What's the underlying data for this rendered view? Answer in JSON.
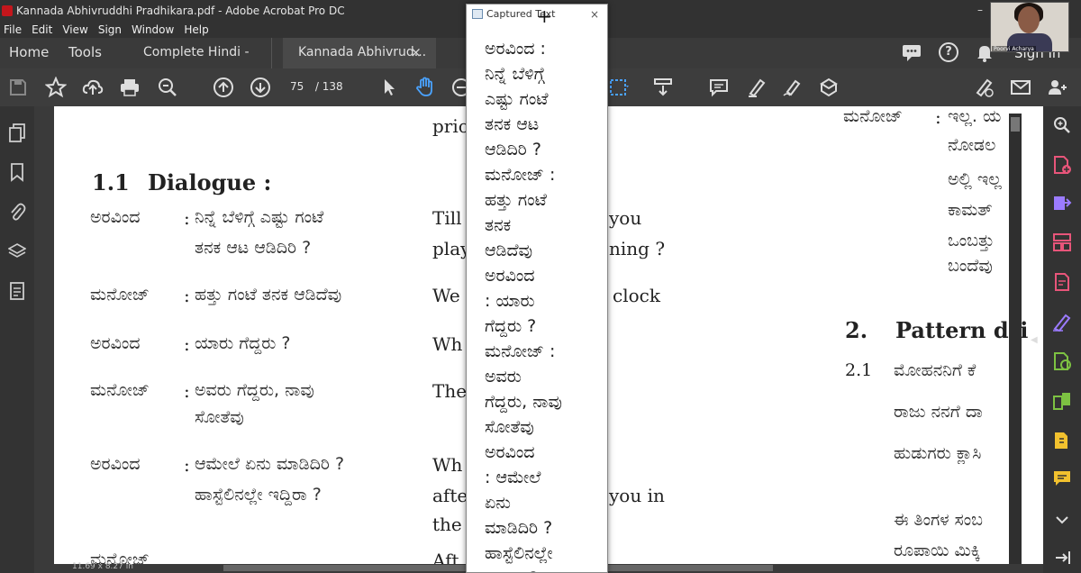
{
  "window": {
    "title": "Kannada Abhivruddhi Pradhikara.pdf - Adobe Acrobat Pro DC",
    "minimize": "–"
  },
  "menu": [
    "File",
    "Edit",
    "View",
    "Sign",
    "Window",
    "Help"
  ],
  "tabs": {
    "home": "Home",
    "tools": "Tools",
    "doc1": "Complete Hindi - R...",
    "doc2": "Kannada Abhivrud...",
    "close": "×",
    "signin": "Sign In"
  },
  "toolbar": {
    "page_current": "75",
    "page_sep": "/",
    "page_total": "138"
  },
  "status": {
    "page_size": "11.69 x 8.27 in"
  },
  "webcam": {
    "name": "Poorvi Acharya"
  },
  "popup": {
    "title": "Captured Text",
    "close": "×",
    "lines": [
      "ಅರವಿಂದ :",
      "ನಿನ್ನೆ ಬೆಳಿಗ್ಗೆ",
      "ಎಷ್ಟು ಗಂಟೆ",
      "ತನಕ ಆಟ",
      "ಆಡಿದಿರಿ ?",
      "ಮನೋಜ್ :",
      "ಹತ್ತು ಗಂಟೆ",
      "ತನಕ",
      "ಆಡಿದೆವು",
      "ಅರವಿಂದ",
      ": ಯಾರು",
      "ಗೆದ್ದರು ?",
      "ಮನೋಜ್ :",
      "ಅವರು",
      "ಗೆದ್ದರು, ನಾವು",
      "ಸೋತೆವು",
      "ಅರವಿಂದ",
      ": ಆಮೇಲೆ",
      "ಏನು",
      "ಮಾಡಿದಿರಿ ?",
      "ಹಾಸ್ಟೆಲಿನಲ್ಲೇ",
      "ಇದ್ದಿರಾ ?"
    ]
  },
  "page1": {
    "top_fragment": "prio",
    "section_num": "1.1",
    "section_title": "Dialogue :",
    "rows": [
      {
        "speaker": "ಅರವಿಂದ",
        "colon": ":",
        "line1": "ನಿನ್ನೆ ಬೆಳಿಗ್ಗೆ ಎಷ್ಟು ಗಂಟೆ",
        "line2": "ತನಕ ಆಟ ಆಡಿದಿರಿ ?",
        "en1": "Till",
        "en1b": "you",
        "en2": "play",
        "en2b": "ning ?"
      },
      {
        "speaker": "ಮನೋಜ್",
        "colon": ":",
        "line1": "ಹತ್ತು ಗಂಟೆ ತನಕ ಆಡಿದೆವು",
        "en1": "We",
        "en1b": "clock"
      },
      {
        "speaker": "ಅರವಿಂದ",
        "colon": ":",
        "line1": "ಯಾರು ಗೆದ್ದರು ?",
        "en1": "Wh"
      },
      {
        "speaker": "ಮನೋಜ್",
        "colon": ":",
        "line1": "ಅವರು ಗೆದ್ದರು, ನಾವು",
        "line2": "ಸೋತೆವು",
        "en1": "The"
      },
      {
        "speaker": "ಅರವಿಂದ",
        "colon": ":",
        "line1": "ಆಮೇಲೆ ಏನು ಮಾಡಿದಿರಿ ?",
        "line2": "ಹಾಸ್ಟೆಲಿನಲ್ಲೇ ಇದ್ದಿರಾ ?",
        "en1": "Wh",
        "en2": "afte",
        "en2b": "you in",
        "en3": "the"
      }
    ],
    "bottom_speaker": "ಮನೋಜ್",
    "bottom_en": "Aft"
  },
  "page2": {
    "speaker": "ಮನೋಜ್",
    "colon": ":",
    "lines": [
      "ಇಲ್ಲ. ಯ",
      "ನೋಡಲ",
      "ಅಲ್ಲಿ ಇಲ್ಲ",
      "ಕಾಮತ್",
      "ಒಂಬತ್ತು",
      "ಬಂದೆವು"
    ],
    "section_num": "2.",
    "section_title": "Pattern dri",
    "sub_num": "2.1",
    "sub_lines": [
      "ಮೋಹನನಿಗೆ ಕೆ",
      "ರಾಜು ನನಗೆ ದಾ",
      "ಹುಡುಗರು ಕ್ಲಾಸಿ",
      "ಈ ತಿಂಗಳ ಸಂಬ",
      "ರೂಪಾಯಿ ಮಿಕ್ಕಿ"
    ]
  },
  "colors": {
    "titlebar": "#323232",
    "toolbar": "#3d3d3d",
    "accent_blue": "#4aa3ff",
    "tool_pink": "#e8557a",
    "tool_purple": "#9b7bff",
    "tool_green": "#7dc242",
    "tool_yellow": "#f2c12e"
  }
}
